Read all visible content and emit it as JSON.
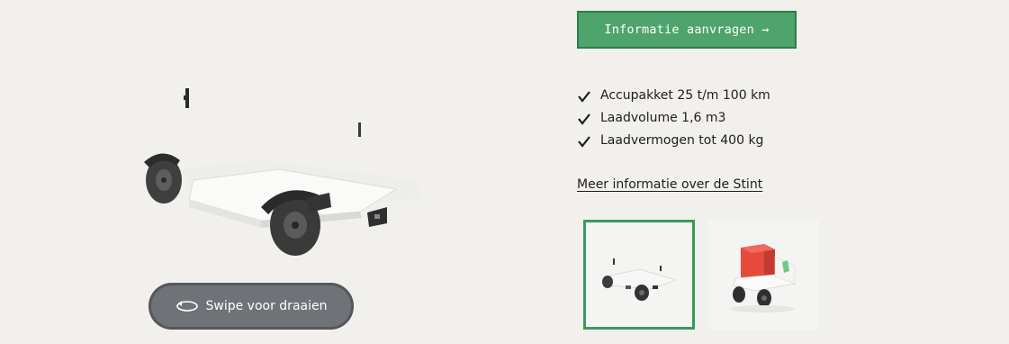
{
  "page": {
    "background": "#f2f0ec"
  },
  "viewer": {
    "swipe_label": "Swipe voor draaien",
    "swipe_icon": "rotate-360-icon"
  },
  "cta": {
    "label": "Informatie aanvragen →",
    "color": "#4fa36c",
    "border": "#2f7b4b"
  },
  "features": [
    {
      "icon": "check-icon",
      "label": "Accupakket 25 t/m 100 km"
    },
    {
      "icon": "check-icon",
      "label": "Laadvolume 1,6 m3"
    },
    {
      "icon": "check-icon",
      "label": "Laadvermogen tot 400 kg"
    }
  ],
  "more_link": {
    "label": "Meer informatie over de Stint"
  },
  "thumbnails": [
    {
      "name": "thumbnail-exploded-chassis",
      "selected": true
    },
    {
      "name": "thumbnail-stint-with-cargo-box",
      "selected": false
    }
  ],
  "accent_colors": {
    "selected_thumb_border": "#3a9a5c",
    "pill_background": "#6f7378"
  }
}
